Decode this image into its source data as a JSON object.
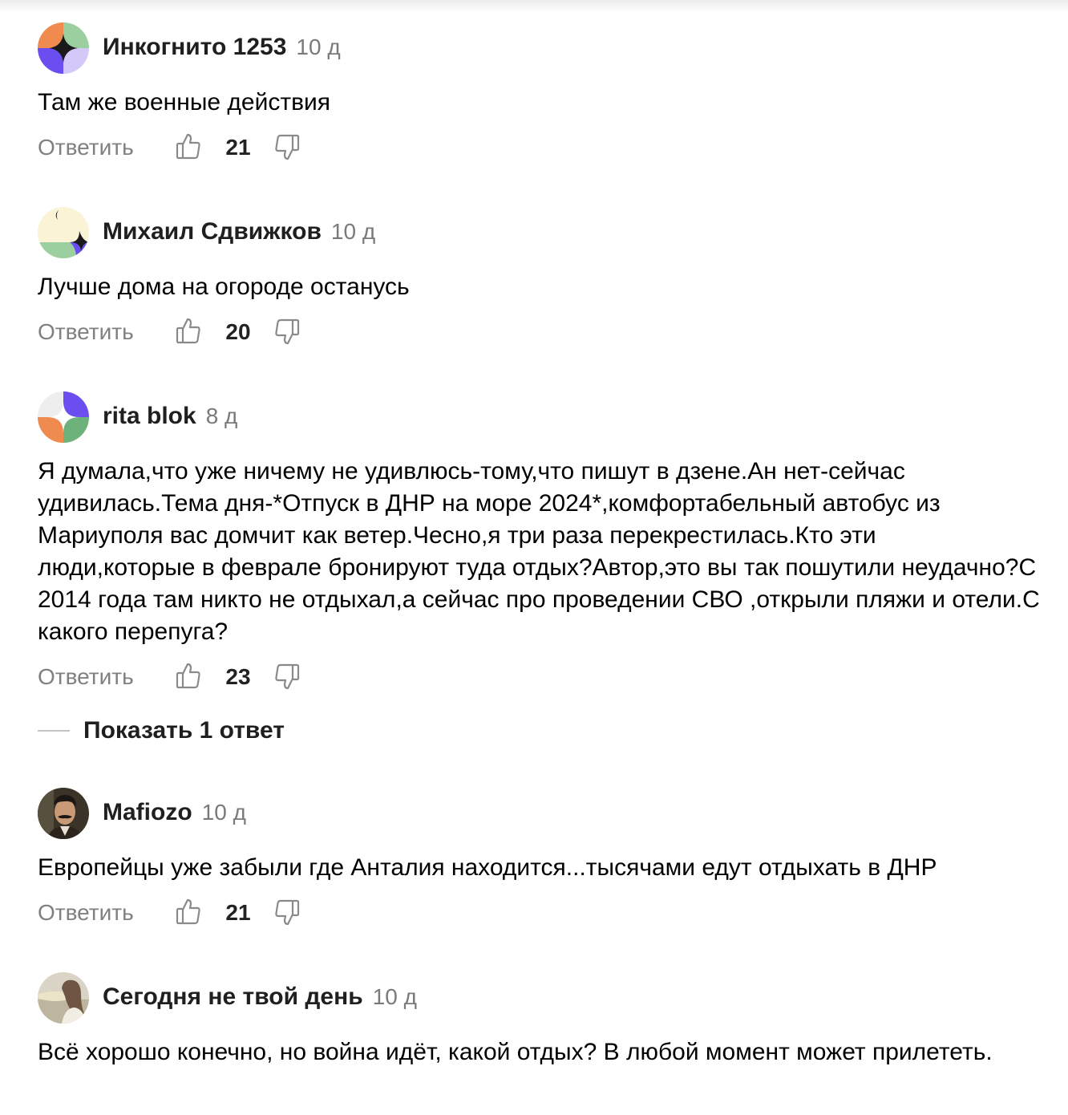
{
  "comments": [
    {
      "author": "Инкогнито 1253",
      "age": "10 д",
      "text": "Там же военные действия",
      "reply_label": "Ответить",
      "likes": "21",
      "avatar_icon": "geometric-avatar-orange-green-purple"
    },
    {
      "author": "Михаил Сдвижков",
      "age": "10 д",
      "text": "Лучше дома на огороде останусь",
      "reply_label": "Ответить",
      "likes": "20",
      "avatar_icon": "geometric-avatar-cream-green-purple"
    },
    {
      "author": "rita blok",
      "age": "8 д",
      "text": "Я думала,что уже ничему не удивлюсь-тому,что пишут в дзене.Ан нет-сейчас удивилась.Тема дня-*Отпуск в ДНР на море 2024*,комфортабельный автобус из Мариуполя вас домчит как ветер.Чесно,я три раза перекрестилась.Кто эти люди,которые в феврале бронируют туда отдых?Автор,это вы так пошутили неудачно?С 2014 года там никто не отдыхал,а сейчас про проведении СВО ,открыли пляжи и отели.С какого перепуга?",
      "reply_label": "Ответить",
      "likes": "23",
      "avatar_icon": "geometric-avatar-purple-orange-green"
    },
    {
      "author": "Mafiozo",
      "age": "10 д",
      "text": "Европейцы уже забыли где Анталия находится...тысячами едут отдыхать в ДНР",
      "reply_label": "Ответить",
      "likes": "21",
      "avatar_icon": "photo-avatar-man"
    },
    {
      "author": "Сегодня не твой день",
      "age": "10 д",
      "text": "Всё хорошо конечно, но война идёт, какой отдых? В любой момент может прилететь.",
      "avatar_icon": "photo-avatar-woman"
    }
  ],
  "show_replies_label": "Показать 1 ответ",
  "icons": {
    "like": "thumbs-up-icon",
    "dislike": "thumbs-down-icon"
  },
  "colors": {
    "secondary_text": "#7a7a7a",
    "accent_purple": "#6b4ef0",
    "accent_green": "#9bcf9f",
    "accent_orange": "#ef8b4e"
  }
}
